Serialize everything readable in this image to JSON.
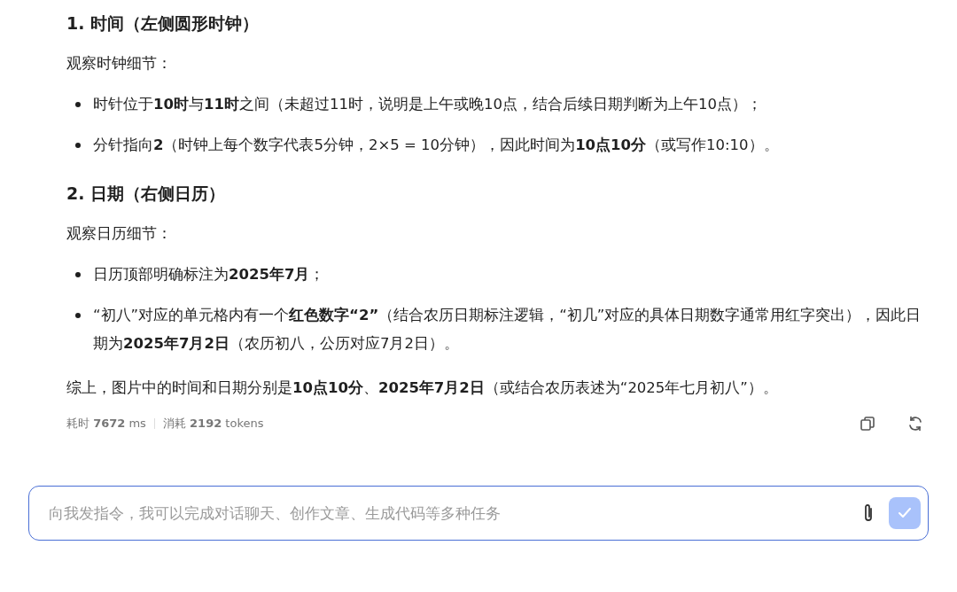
{
  "answer": {
    "blocks": [
      {
        "kind": "heading",
        "text": "1. 时间（左侧圆形时钟）"
      },
      {
        "kind": "paragraph",
        "text": "观察时钟细节："
      },
      {
        "kind": "bullets",
        "items": [
          "时针位于**10时**与**11时**之间（未超过11时，说明是上午或晚10点，结合后续日期判断为上午10点）；",
          "分针指向**2**（时钟上每个数字代表5分钟，2×5 = 10分钟），因此时间为**10点10分**（或写作10:10）。"
        ]
      },
      {
        "kind": "heading",
        "text": "2. 日期（右侧日历）"
      },
      {
        "kind": "paragraph",
        "text": "观察日历细节："
      },
      {
        "kind": "bullets",
        "items": [
          "日历顶部明确标注为**2025年7月**；",
          "“初八”对应的单元格内有一个**红色数字“2”**（结合农历日期标注逻辑，“初几”对应的具体日期数字通常用红字突出），因此日期为**2025年7月2日**（农历初八，公历对应7月2日）。"
        ]
      },
      {
        "kind": "paragraph",
        "text": "综上，图片中的时间和日期分别是**10点10分**、**2025年7月2日**（或结合农历表述为“2025年七月初八”）。"
      }
    ]
  },
  "stats": [
    "耗时 **7672** ms",
    "消耗 **2192** tokens"
  ],
  "input": {
    "placeholder": "向我发指令，我可以完成对话聊天、创作文章、生成代码等多种任务",
    "send_disabled": true
  }
}
